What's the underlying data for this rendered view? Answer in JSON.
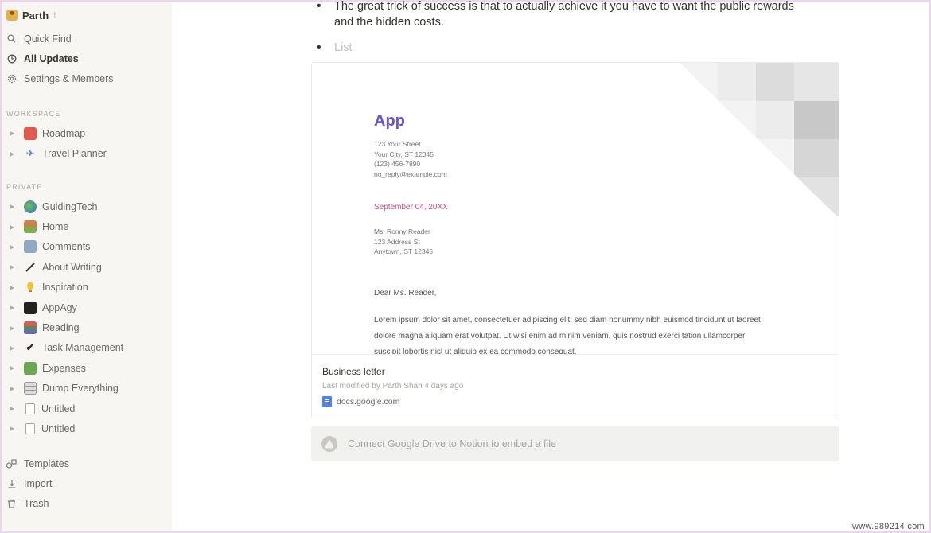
{
  "workspace": {
    "name": "Parth"
  },
  "nav": [
    {
      "label": "Quick Find",
      "icon": "search-icon"
    },
    {
      "label": "All Updates",
      "icon": "clock-icon",
      "active": true
    },
    {
      "label": "Settings & Members",
      "icon": "gear-icon"
    }
  ],
  "sections": {
    "workspace_label": "WORKSPACE",
    "private_label": "PRIVATE"
  },
  "workspace_pages": [
    {
      "label": "Roadmap",
      "icon": "car-icon"
    },
    {
      "label": "Travel Planner",
      "icon": "plane-icon"
    }
  ],
  "private_pages": [
    {
      "label": "GuidingTech",
      "icon": "globe-icon"
    },
    {
      "label": "Home",
      "icon": "house-icon"
    },
    {
      "label": "Comments",
      "icon": "robot-icon"
    },
    {
      "label": "About Writing",
      "icon": "pen-icon"
    },
    {
      "label": "Inspiration",
      "icon": "bulb-icon"
    },
    {
      "label": "AppAgy",
      "icon": "laptop-icon"
    },
    {
      "label": "Reading",
      "icon": "books-icon"
    },
    {
      "label": "Task Management",
      "icon": "checkmark-icon"
    },
    {
      "label": "Expenses",
      "icon": "money-icon"
    },
    {
      "label": "Dump Everything",
      "icon": "cabinet-icon"
    },
    {
      "label": "Untitled",
      "icon": "page-icon"
    },
    {
      "label": "Untitled",
      "icon": "page-icon"
    }
  ],
  "bottom_nav": [
    {
      "label": "Templates",
      "icon": "shapes-icon"
    },
    {
      "label": "Import",
      "icon": "download-icon"
    },
    {
      "label": "Trash",
      "icon": "trash-icon"
    }
  ],
  "content": {
    "bullet_1": "The great trick of success is that to actually achieve it you have to want the public rewards and the hidden costs.",
    "bullet_2_placeholder": "List"
  },
  "embed": {
    "preview": {
      "logo": "App",
      "address": [
        "123 Your Street",
        "Your City, ST 12345",
        "(123) 456-7890",
        "no_reply@example.com"
      ],
      "date": "September 04, 20XX",
      "recipient": [
        "Ms. Ronny Reader",
        "123 Address St",
        "Anytown, ST 12345"
      ],
      "salutation": "Dear Ms. Reader,",
      "body": "Lorem ipsum dolor sit amet, consectetuer adipiscing elit, sed diam nonummy nibh euismod tincidunt ut laoreet dolore magna aliquam erat volutpat. Ut wisi enim ad minim veniam, quis nostrud exerci tation ullamcorper suscipit lobortis nisl ut aliquip ex ea commodo consequat."
    },
    "title": "Business letter",
    "meta": "Last modified by Parth Shah 4 days ago",
    "link": "docs.google.com"
  },
  "connect": {
    "label": "Connect Google Drive to Notion to embed a file"
  },
  "watermark": "www.989214.com",
  "colors": {
    "sidebar_bg": "#f7f6f3",
    "logo_purple": "#6a52d8",
    "date_pink": "#d94a8a",
    "gdoc_blue": "#4a84f0"
  }
}
